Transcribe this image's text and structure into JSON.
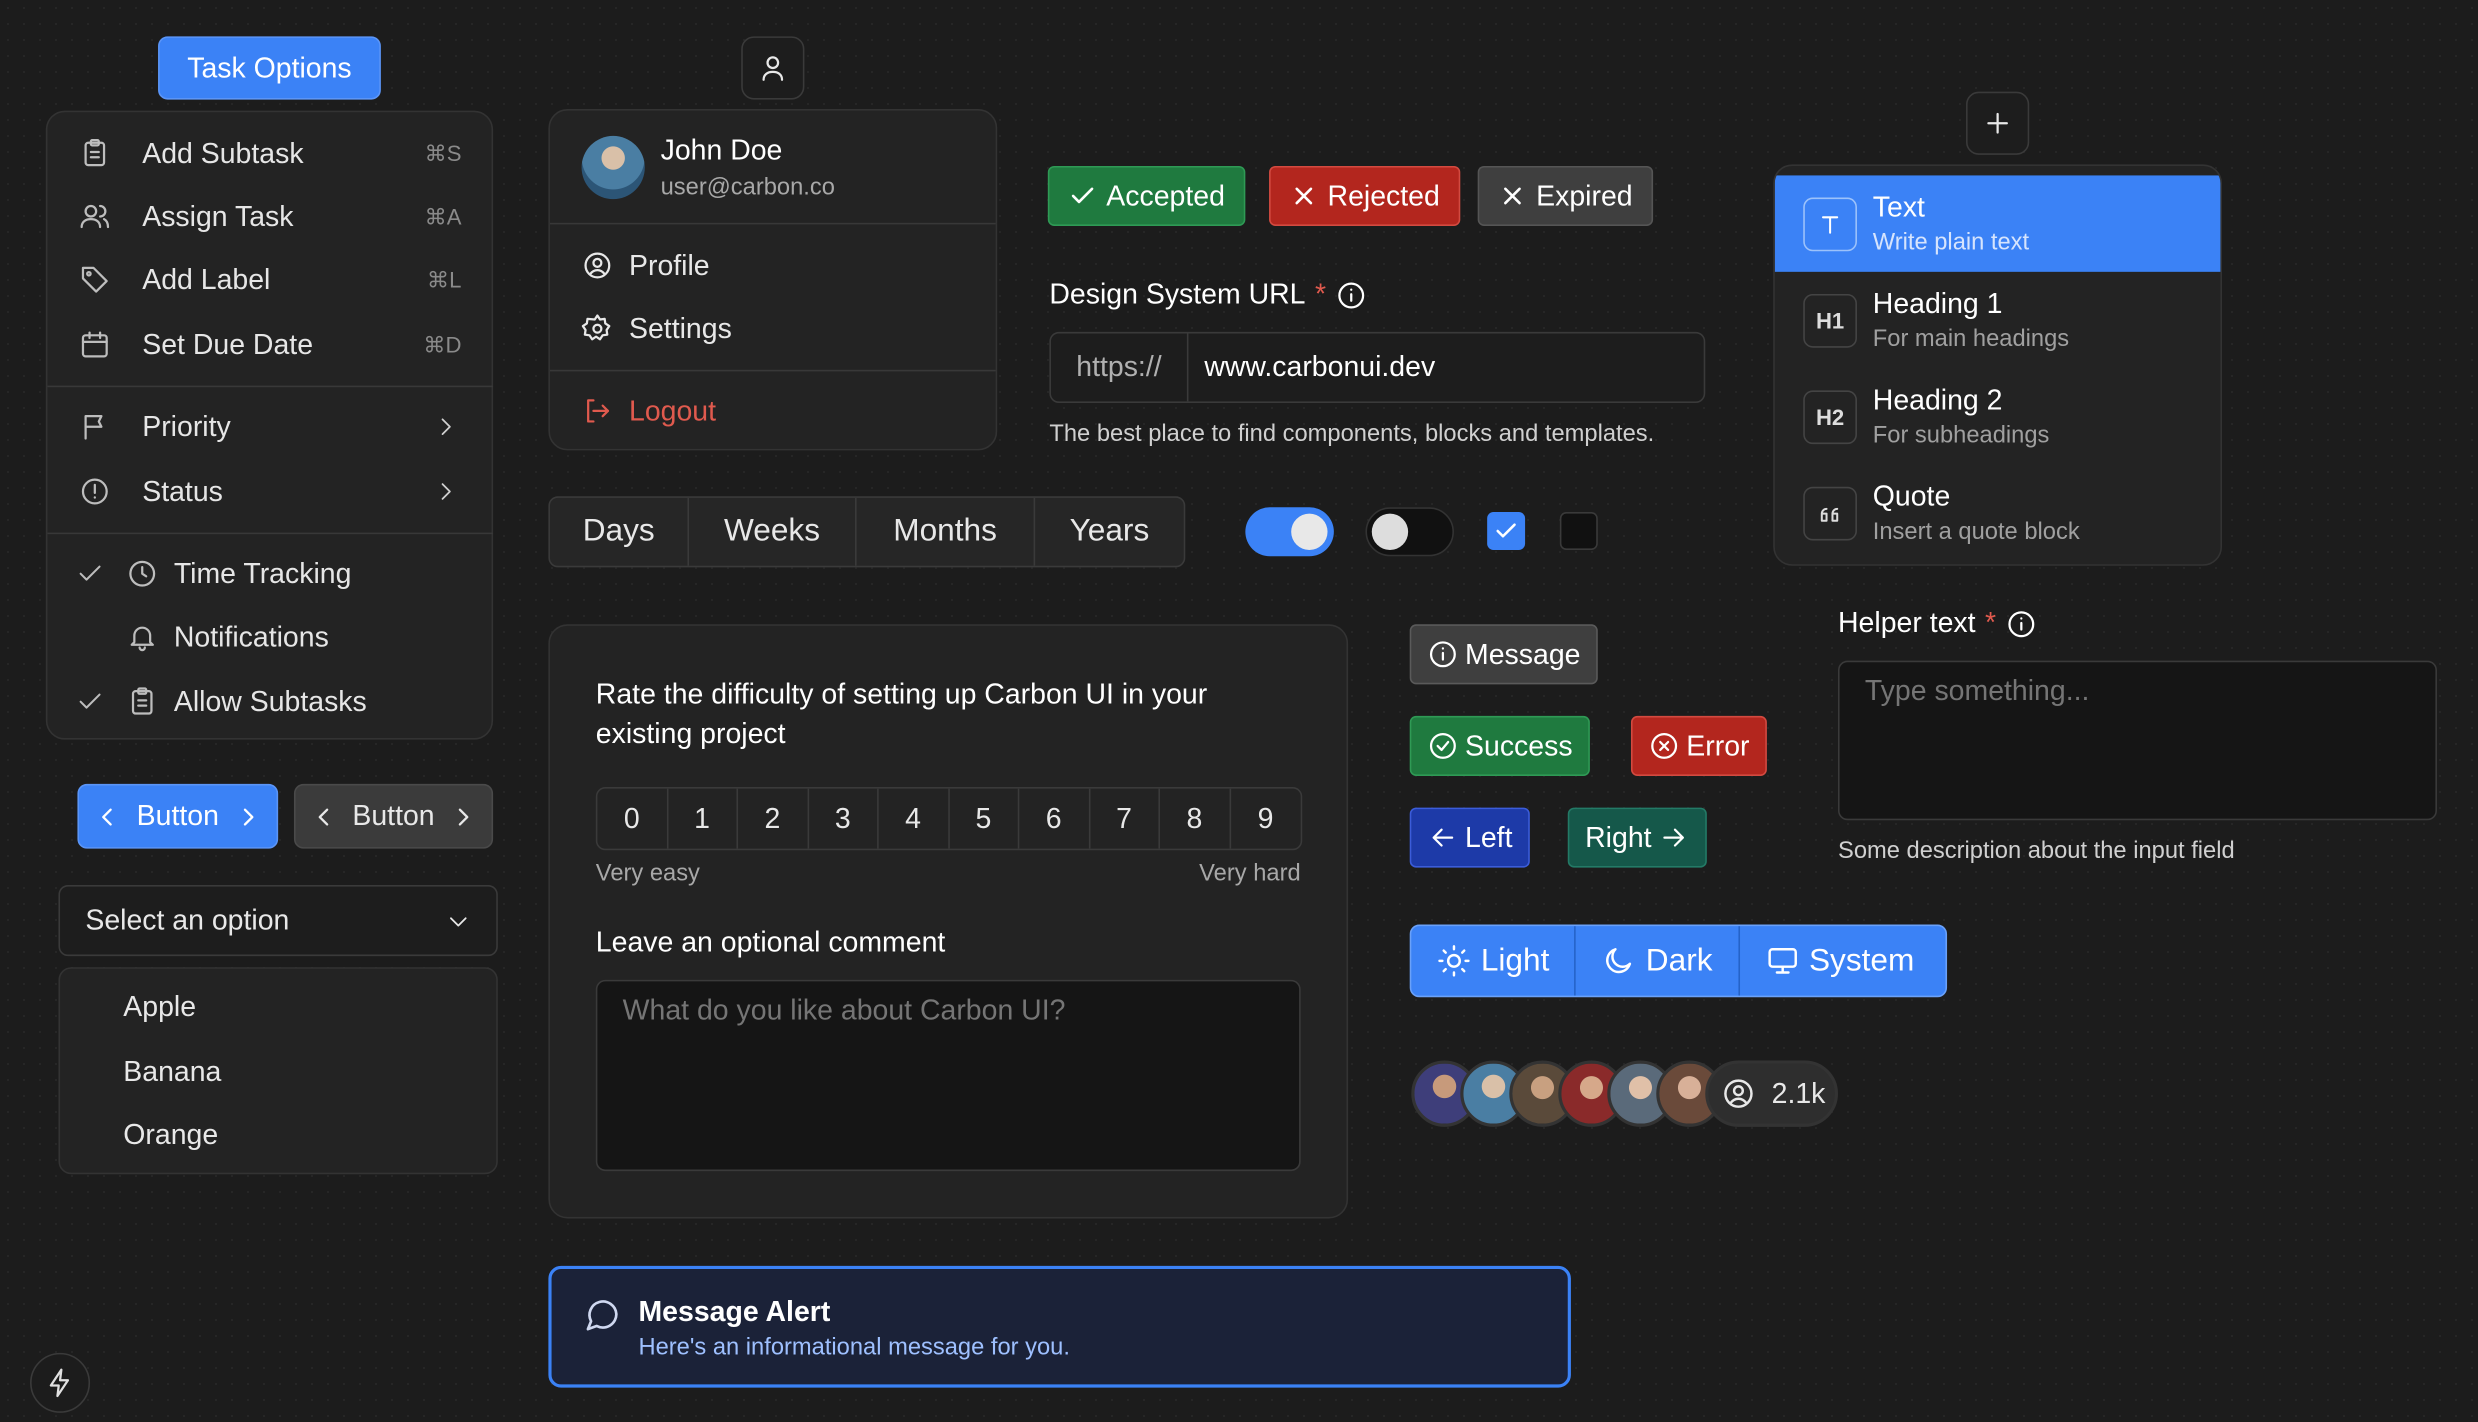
{
  "task_menu": {
    "trigger_label": "Task Options",
    "items": [
      {
        "label": "Add Subtask",
        "shortcut": "⌘S"
      },
      {
        "label": "Assign Task",
        "shortcut": "⌘A"
      },
      {
        "label": "Add Label",
        "shortcut": "⌘L"
      },
      {
        "label": "Set Due Date",
        "shortcut": "⌘D"
      }
    ],
    "submenus": [
      {
        "label": "Priority"
      },
      {
        "label": "Status"
      }
    ],
    "checks": [
      {
        "label": "Time Tracking",
        "checked": true
      },
      {
        "label": "Notifications",
        "checked": false
      },
      {
        "label": "Allow Subtasks",
        "checked": true
      }
    ]
  },
  "buttons": {
    "primary_label": "Button",
    "secondary_label": "Button"
  },
  "select": {
    "selected": "Select an option",
    "options": [
      "Apple",
      "Banana",
      "Orange"
    ]
  },
  "user_menu": {
    "name": "John Doe",
    "email": "user@carbon.co",
    "profile": "Profile",
    "settings": "Settings",
    "logout": "Logout"
  },
  "status_badges": {
    "accepted": "Accepted",
    "rejected": "Rejected",
    "expired": "Expired"
  },
  "url_field": {
    "label": "Design System URL",
    "required_mark": "*",
    "prefix": "https://",
    "value": "www.carbonui.dev",
    "helper": "The best place to find components, blocks and templates."
  },
  "range_tabs": [
    "Days",
    "Weeks",
    "Months",
    "Years"
  ],
  "toggles": {
    "switch1": true,
    "switch2": false,
    "checkbox1": true,
    "checkbox2": false
  },
  "survey": {
    "question": "Rate the difficulty of setting up Carbon UI in your existing project",
    "scale": [
      "0",
      "1",
      "2",
      "3",
      "4",
      "5",
      "6",
      "7",
      "8",
      "9"
    ],
    "min_label": "Very easy",
    "max_label": "Very hard",
    "comment_label": "Leave an optional comment",
    "comment_placeholder": "What do you like about Carbon UI?"
  },
  "alert": {
    "title": "Message Alert",
    "message": "Here's an informational message for you."
  },
  "tags": {
    "message": "Message",
    "success": "Success",
    "error": "Error",
    "left": "Left",
    "right": "Right"
  },
  "theme_switch": {
    "light": "Light",
    "dark": "Dark",
    "system": "System"
  },
  "avatars": {
    "count_label": "2.1k"
  },
  "insert_menu": {
    "items": [
      {
        "icon": "T",
        "title": "Text",
        "subtitle": "Write plain text"
      },
      {
        "icon": "H1",
        "title": "Heading 1",
        "subtitle": "For main headings"
      },
      {
        "icon": "H2",
        "title": "Heading 2",
        "subtitle": "For subheadings"
      },
      {
        "icon": "quote",
        "title": "Quote",
        "subtitle": "Insert a quote block"
      }
    ]
  },
  "helper_field": {
    "label": "Helper text",
    "required_mark": "*",
    "placeholder": "Type something...",
    "description": "Some description about the input field"
  },
  "colors": {
    "accent": "#3b82f6",
    "success": "#1f7a3f",
    "danger": "#b3261e",
    "neutral": "#3f3f3f"
  }
}
